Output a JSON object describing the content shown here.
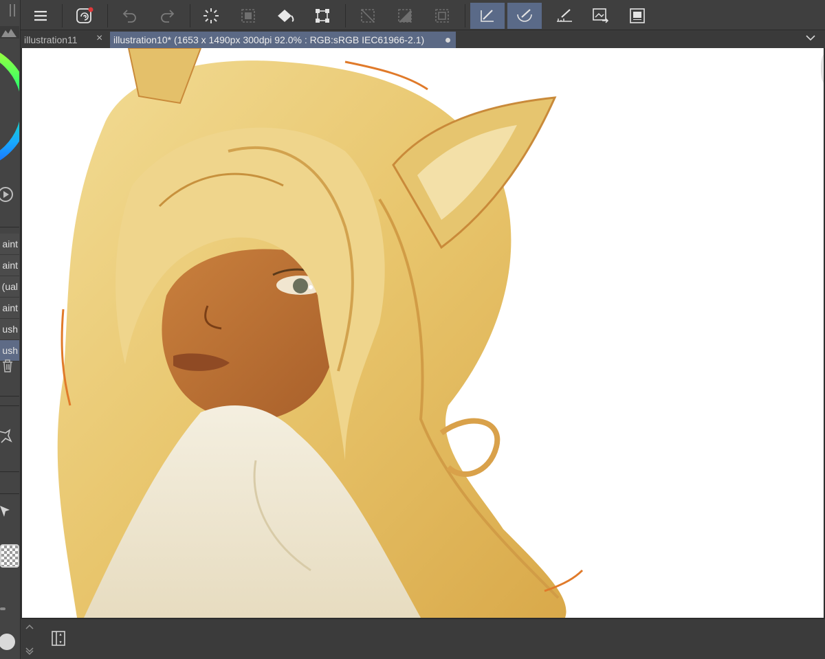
{
  "tabs": [
    {
      "label": "illustration11",
      "active": false
    },
    {
      "label": "illustration10* (1653 x 1490px 300dpi 92.0% : RGB:sRGB IEC61966-2.1)",
      "active": true
    }
  ],
  "brush_list": [
    "aint",
    "aint",
    "ual)",
    "aint",
    "ush",
    "ush"
  ],
  "brush_selected_index": 5,
  "toolbar_icons": [
    "menu-icon",
    "clip-studio-icon",
    "undo-icon",
    "redo-icon",
    "loading-icon",
    "select-layer-icon",
    "fill-icon",
    "transform-icon",
    "clear-selection-icon",
    "select-invert-icon",
    "selection-border-icon",
    "vector-eraser-icon",
    "snap-brush-icon",
    "ruler-icon",
    "export-icon",
    "layer-icon"
  ],
  "colors": {
    "accent": "#5a6a88",
    "panel": "#3f3f3f",
    "canvas": "#ffffff",
    "notification_dot": "#e0383a"
  }
}
